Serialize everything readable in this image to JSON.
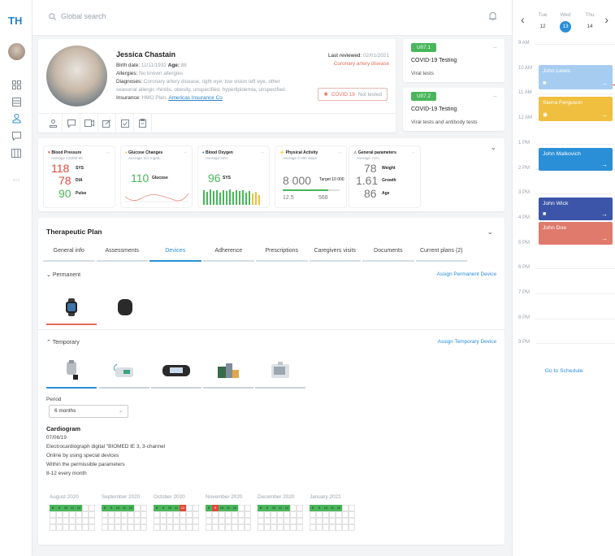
{
  "app": {
    "logo": "TH"
  },
  "search": {
    "placeholder": "Global search"
  },
  "patient": {
    "name": "Jessica Chastain",
    "birth_label": "Birth date:",
    "birth": "11/11/1932",
    "age_label": "Age:",
    "age": "86",
    "allergies_label": "Allergies:",
    "allergies": "No known allergies",
    "diagnoses_label": "Diagnoses:",
    "diagnoses_1": "Coronary artery disease, right eye, low vision left eye, other",
    "diagnoses_2": "seasonal allergic rhinitis, obesity, unspecified, hyperlipidemia, unspecified",
    "insurance_label": "Insurance:",
    "insurance_plan": "HMO Plan.",
    "insurance_link": "Americas Insurance Co",
    "reviewed_label": "Last reviewed:",
    "reviewed": "02/01/2021",
    "reviewed_note": "Coronary artery disease",
    "covid_label": "COVID 19",
    "covid_status": "Not tested"
  },
  "tests": [
    {
      "code": "U07.1",
      "title": "COVID-19 Testing",
      "sub": "Viral tests"
    },
    {
      "code": "U07.2",
      "title": "COVID-19 Testing",
      "sub": "Viral tests and antibody tests"
    }
  ],
  "vitals": {
    "bp": {
      "title": "Blood Pressure",
      "avg": "Average 120/80 90",
      "sys": "118",
      "sys_l": "SYS",
      "dia": "78",
      "dia_l": "DIA",
      "pulse": "90",
      "pulse_l": "Pulse"
    },
    "glucose": {
      "title": "Glucose Changes",
      "avg": "Average 110 mg/dL",
      "value": "110",
      "label": "Glucose"
    },
    "oxygen": {
      "title": "Blood Oxygen",
      "avg": "Average 92%",
      "value": "96",
      "label": "SYS"
    },
    "activity": {
      "title": "Physical Activity",
      "avg": "Average 6 000 steps",
      "value": "8 000",
      "target": "Target 10 000",
      "a": "12.5",
      "b": "568"
    },
    "general": {
      "title": "General parameters",
      "avg": "Average 71%",
      "weight": "78",
      "weight_l": "Weight",
      "growth": "1.61",
      "growth_l": "Growth",
      "age": "86",
      "age_l": "Age"
    }
  },
  "plan": {
    "title": "Therapeutic Plan",
    "tabs": [
      "General info",
      "Assessments",
      "Devices",
      "Adherence",
      "Prescriptions",
      "Caregivers visits",
      "Documents",
      "Current plans (2)"
    ],
    "permanent": "Permanent",
    "assign_permanent": "Assign Permanent Device",
    "temporary": "Temporary",
    "assign_temporary": "Assign Temporary Device",
    "period_label": "Period",
    "period_value": "6 months",
    "cg_title": "Cardiogram",
    "cg_date": "07/06/19",
    "cg_1": "Electrocardiograph digital \"BIOMED IE 3, 3-channel",
    "cg_2": "Online by using special devices",
    "cg_3": "Within the permissible parameters",
    "cg_4": "8-12 every month",
    "months": [
      "August 2020",
      "September 2020",
      "October 2020",
      "November 2020",
      "December 2020",
      "January 2021"
    ],
    "days": [
      "8",
      "9",
      "10",
      "11",
      "12"
    ]
  },
  "calendar": {
    "days": [
      {
        "d": "Tue",
        "n": "12"
      },
      {
        "d": "Wed",
        "n": "13"
      },
      {
        "d": "Thu",
        "n": "14"
      }
    ],
    "hours": [
      "9 AM",
      "10 AM",
      "11 AM",
      "12 AM",
      "1 PM",
      "2 PM",
      "3 PM",
      "4 PM",
      "5 PM",
      "6 PM",
      "7 PM",
      "8 PM",
      "9 PM"
    ],
    "events": [
      "John Lewis",
      "Sierra Ferguson",
      "John Malkovich",
      "John Wick",
      "John Doe"
    ],
    "goto": "Go to Schedule",
    "colors": {
      "blue_light": "#a6cdf0",
      "yellow": "#f0bf3f",
      "blue": "#2a8fd6",
      "navy": "#3c55a8",
      "red": "#df7a6c"
    }
  }
}
